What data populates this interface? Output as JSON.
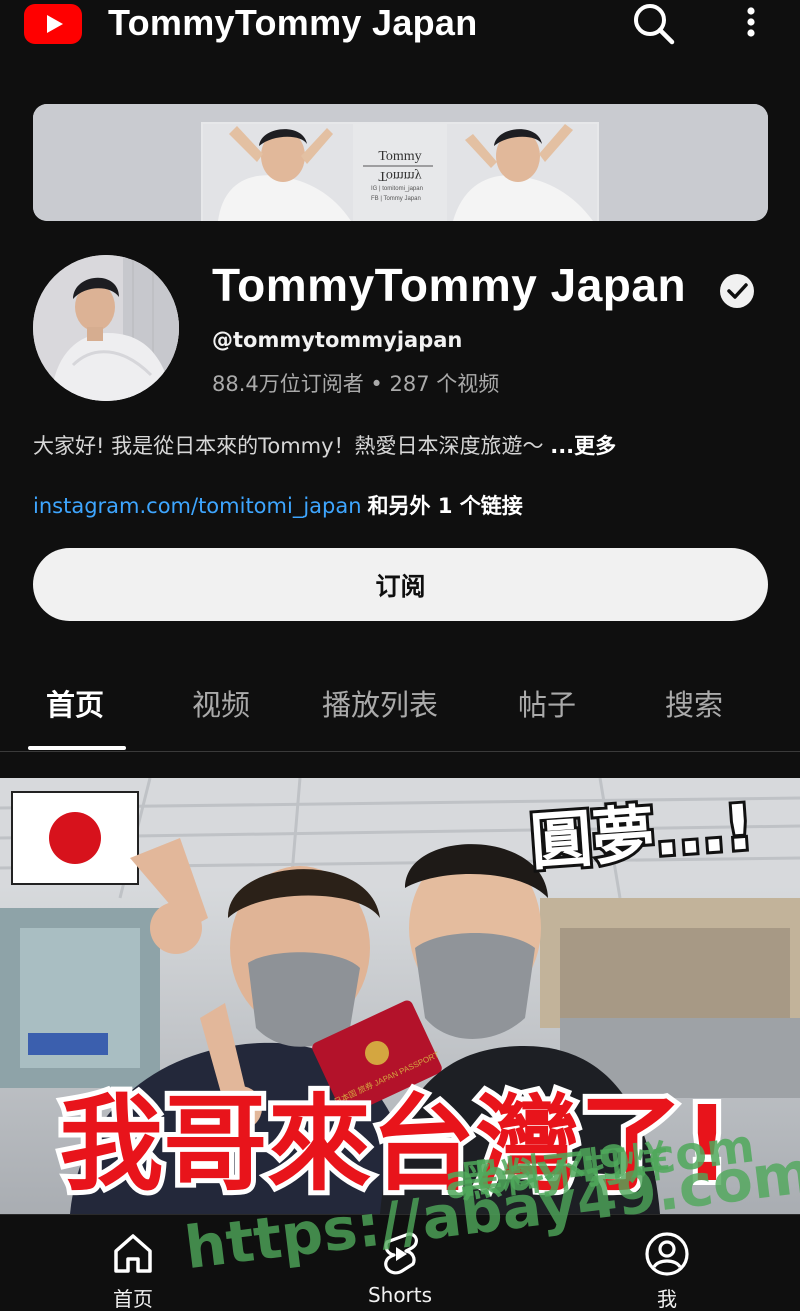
{
  "header": {
    "title": "TommyTommy Japan",
    "icons": {
      "logo": "youtube-logo-icon",
      "search": "search-icon",
      "more": "more-vert-icon"
    }
  },
  "banner": {
    "name_top": "Tommy",
    "name_bottom": "Tommy",
    "line1": "IG | tomitomi_japan",
    "line2": "FB | Tommy Japan"
  },
  "channel": {
    "name": "TommyTommy Japan",
    "handle": "@tommytommyjapan",
    "stats": "88.4万位订阅者 • 287 个视频",
    "description": "大家好! 我是從日本來的Tommy！熱愛日本深度旅遊～ ",
    "more_label": "...更多",
    "link_text": "instagram.com/tomitomi_japan",
    "link_extra": "和另外 1 个链接",
    "subscribe_label": "订阅"
  },
  "tabs": [
    {
      "label": "首页",
      "active": true
    },
    {
      "label": "视频",
      "active": false
    },
    {
      "label": "播放列表",
      "active": false
    },
    {
      "label": "帖子",
      "active": false
    },
    {
      "label": "搜索",
      "active": false
    }
  ],
  "featured_video": {
    "caption_main": "我哥來台灣了!",
    "caption_top": "圓夢...!",
    "passport_text": "日本国 旅券 JAPAN PASSPORT",
    "watermark_top": "黑料不打烊",
    "watermark_domain": "abay49.com",
    "watermark_url": "https://abay49.com"
  },
  "bottom_nav": [
    {
      "label": "首页",
      "icon": "home-icon"
    },
    {
      "label": "Shorts",
      "icon": "shorts-icon"
    },
    {
      "label": "我",
      "icon": "account-icon"
    }
  ],
  "colors": {
    "background": "#0f0f0f",
    "brand_red": "#ff0000",
    "link_blue": "#3ea6ff",
    "subscribe_bg": "#f1f1f1",
    "caption_red": "#e8141b"
  }
}
